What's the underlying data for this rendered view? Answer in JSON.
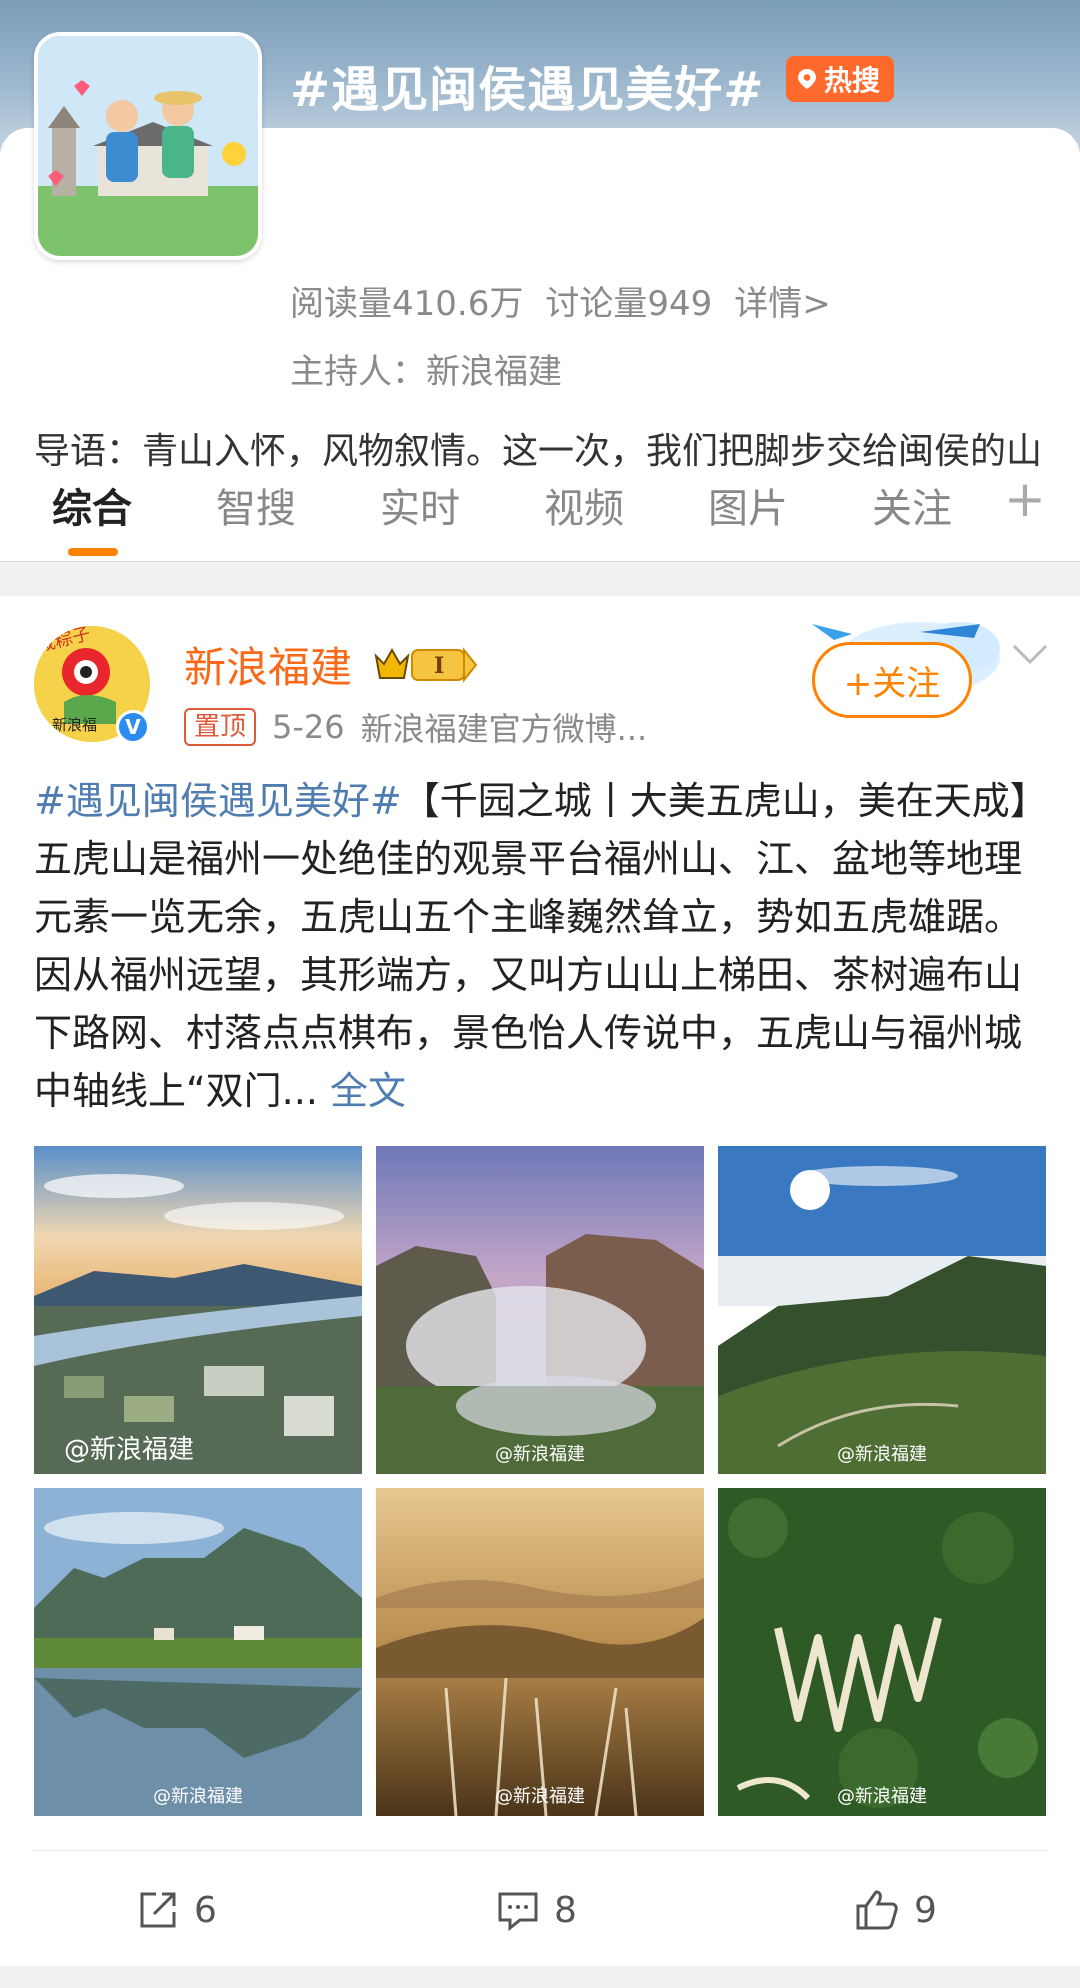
{
  "topic": {
    "title": "#遇见闽侯遇见美好#",
    "hot_badge": "热搜",
    "reads": "阅读量410.6万",
    "discussions": "讨论量949",
    "details": "详情>",
    "host": "主持人：新浪福建",
    "intro": "导语：青山入怀，风物叙情。这一次，我们把脚步交给闽侯的山野与街巷，用镜头收藏每一帧不期而遇的美好。"
  },
  "tabs": [
    {
      "label": "综合",
      "active": true
    },
    {
      "label": "智搜"
    },
    {
      "label": "实时"
    },
    {
      "label": "视频"
    },
    {
      "label": "图片"
    },
    {
      "label": "关注"
    }
  ],
  "tabs_add": "+",
  "post": {
    "author": "新浪福建",
    "badge_level": "I",
    "avatar_text": "咸粽子",
    "avatar_sub": "新浪福",
    "pinned": "置顶",
    "date": "5-26",
    "source": "新浪福建官方微博...",
    "follow": "+关注",
    "hashtag": "#遇见闽侯遇见美好#",
    "body": "【千园之城丨大美五虎山，美在天成】五虎山是福州一处绝佳的观景平台福州山、江、盆地等地理元素一览无余，五虎山五个主峰巍然耸立，势如五虎雄踞。因从福州远望，其形端方，又叫方山山上梯田、茶树遍布山下路网、村落点点棋布，景色怡人传说中，五虎山与福州城中轴线上“双门...",
    "more": "全文",
    "watermark": "@新浪福建",
    "images": [
      {
        "name": "photo-river-city"
      },
      {
        "name": "photo-misty-peaks"
      },
      {
        "name": "photo-sunny-plateau"
      },
      {
        "name": "photo-lake-reflection"
      },
      {
        "name": "photo-golden-reeds"
      },
      {
        "name": "photo-winding-road"
      }
    ],
    "reposts": "6",
    "comments": "8",
    "likes": "9"
  },
  "colors": {
    "accent": "#ff8200",
    "link": "#507daf",
    "author": "#f86a1a",
    "hot": "#ff6a2c"
  }
}
